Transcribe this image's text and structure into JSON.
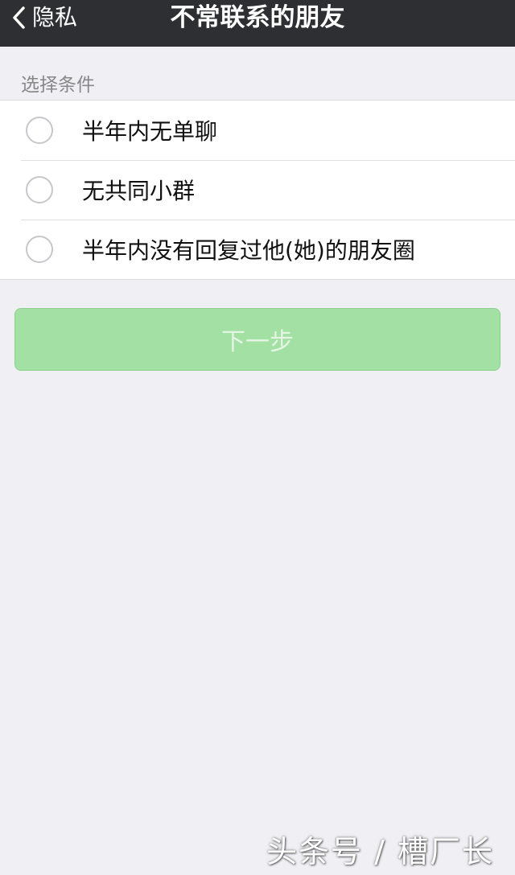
{
  "navbar": {
    "back_label": "隐私",
    "title": "不常联系的朋友"
  },
  "section": {
    "header": "选择条件",
    "options": [
      {
        "label": "半年内无单聊",
        "selected": false
      },
      {
        "label": "无共同小群",
        "selected": false
      },
      {
        "label": "半年内没有回复过他(她)的朋友圈",
        "selected": false
      }
    ]
  },
  "next_button": {
    "label": "下一步",
    "enabled": false
  },
  "watermark": "头条号 / 槽厂长",
  "colors": {
    "navbar_bg": "#2e2f33",
    "page_bg": "#efeff4",
    "button_disabled_bg": "#a3e0a3",
    "button_disabled_text": "#e4f5e4"
  },
  "icons": {
    "back": "chevron-left-icon",
    "option_unselected": "radio-unchecked-icon"
  }
}
